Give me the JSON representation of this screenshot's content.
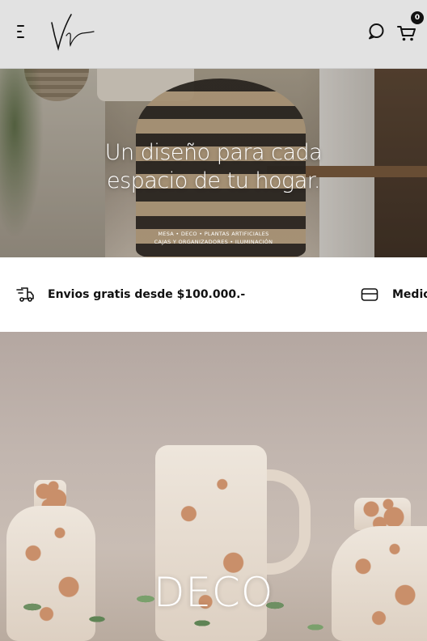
{
  "header": {
    "menu_icon": "hamburger-menu-icon",
    "logo_text": "Vr",
    "search_icon": "chat-search-icon",
    "cart_icon": "shopping-cart-icon",
    "cart_count": "0",
    "background": "#e2e2e2"
  },
  "hero": {
    "title_line1": "Un diseño para cada",
    "title_line2": "espacio de tu hogar.",
    "categories_line1": "MESA • DECO •  PLANTAS ARTIFICIALES",
    "categories_line2": "CAJAS Y ORGANIZADORES • ILUMINACIÓN"
  },
  "infobar": {
    "items": [
      {
        "icon": "delivery-truck-icon",
        "text": "Envios gratis desde $100.000.-"
      },
      {
        "icon": "credit-card-icon",
        "text": "Medios"
      }
    ]
  },
  "banner": {
    "title": "DECO"
  }
}
